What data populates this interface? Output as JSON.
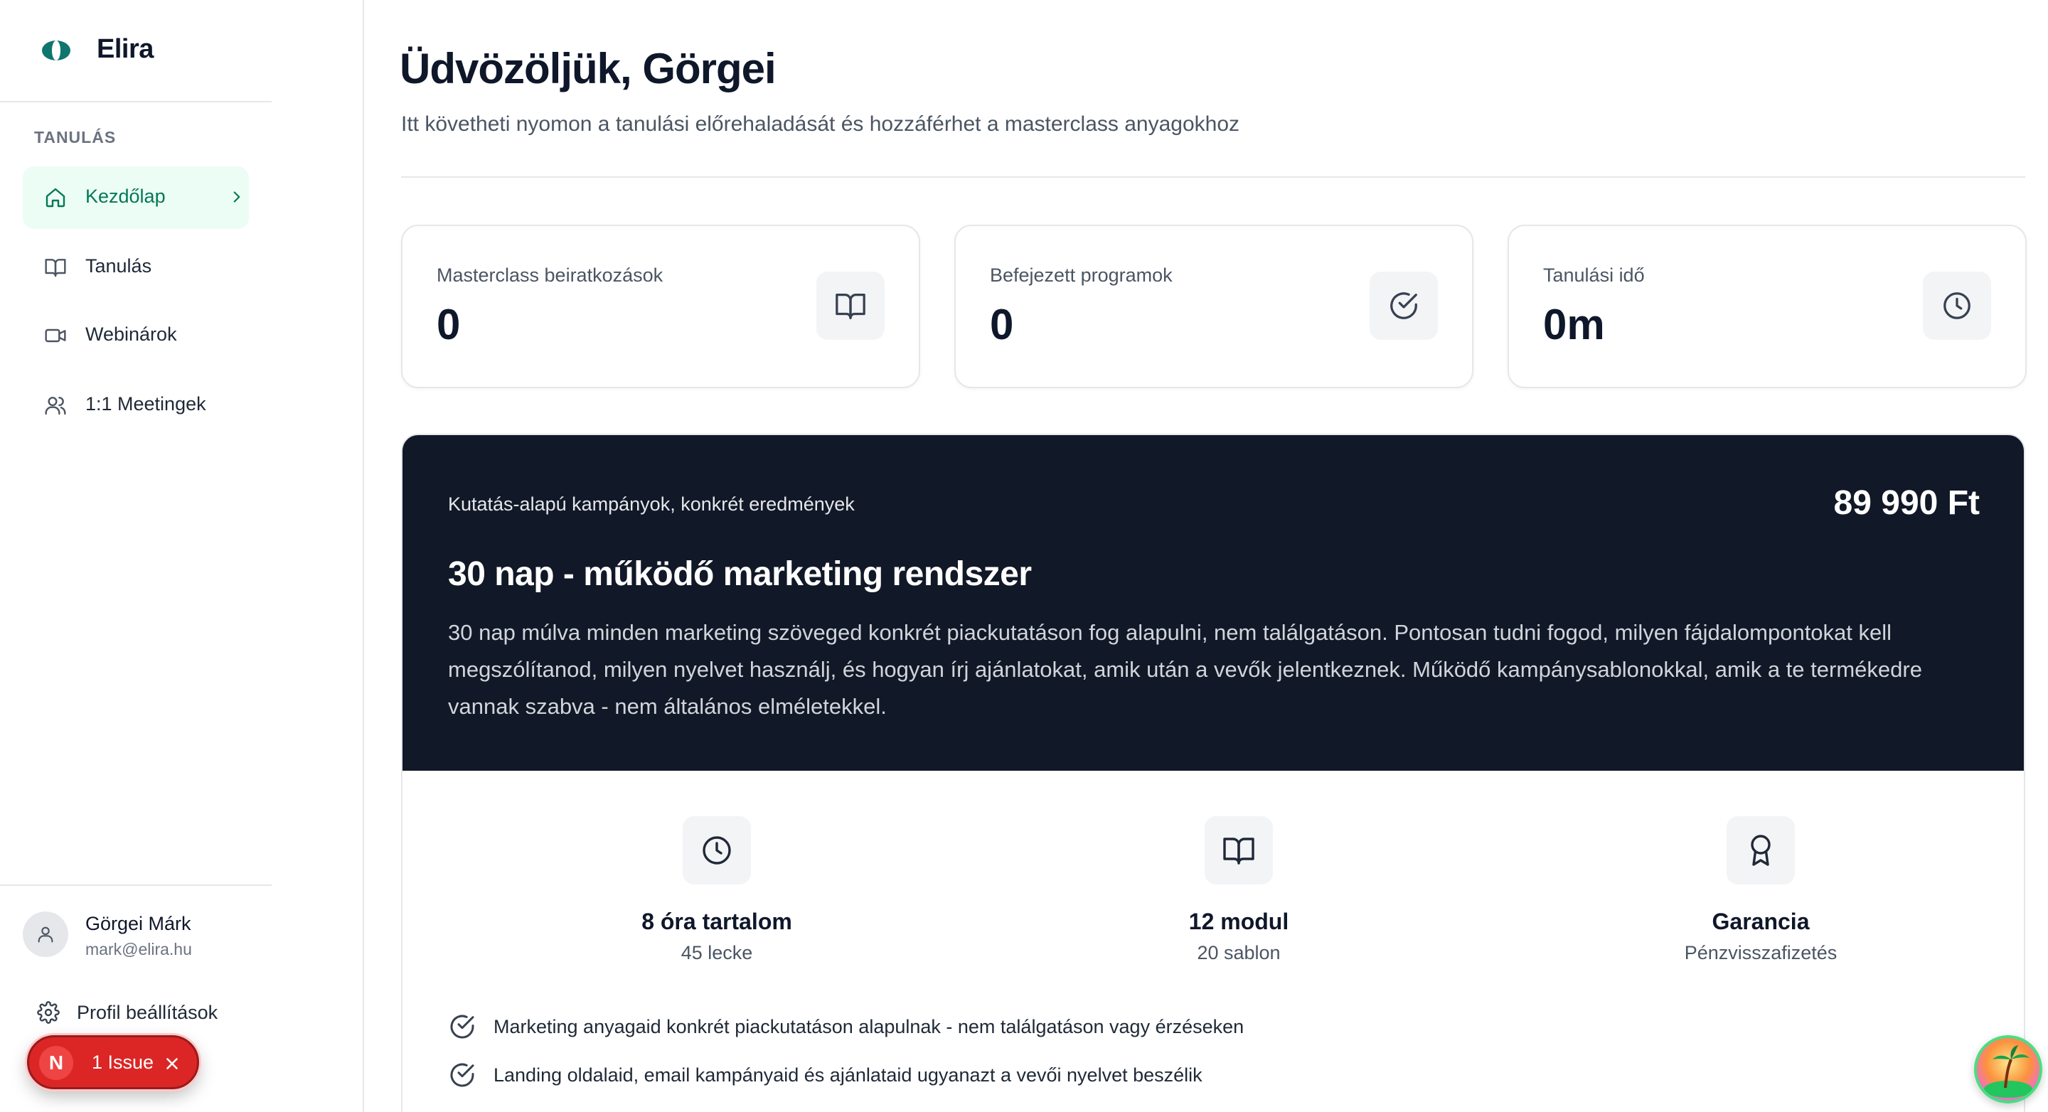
{
  "app": {
    "name": "Elira"
  },
  "sidebar": {
    "section_label": "TANULÁS",
    "items": [
      {
        "label": "Kezdőlap",
        "icon": "home-icon",
        "active": true
      },
      {
        "label": "Tanulás",
        "icon": "book-icon",
        "active": false
      },
      {
        "label": "Webinárok",
        "icon": "video-icon",
        "active": false
      },
      {
        "label": "1:1 Meetingek",
        "icon": "users-icon",
        "active": false
      }
    ],
    "user": {
      "name": "Görgei Márk",
      "email": "mark@elira.hu"
    },
    "profile_settings_label": "Profil beállítások",
    "issue_badge": {
      "letter": "N",
      "label": "1 Issue"
    }
  },
  "header": {
    "title": "Üdvözöljük, Görgei",
    "subtitle": "Itt követheti nyomon a tanulási előrehaladását és hozzáférhet a masterclass anyagokhoz"
  },
  "stats": [
    {
      "label": "Masterclass beiratkozások",
      "value": "0",
      "icon": "book-open-icon"
    },
    {
      "label": "Befejezett programok",
      "value": "0",
      "icon": "check-circle-icon"
    },
    {
      "label": "Tanulási idő",
      "value": "0m",
      "icon": "clock-icon"
    }
  ],
  "course": {
    "tagline": "Kutatás-alapú kampányok, konkrét eredmények",
    "price": "89 990 Ft",
    "title": "30 nap - működő marketing rendszer",
    "description": "30 nap múlva minden marketing szöveged konkrét piackutatáson fog alapulni, nem találgatáson. Pontosan tudni fogod, milyen fájdalompontokat kell megszólítanod, milyen nyelvet használj, és hogyan írj ajánlatokat, amik után a vevők jelentkeznek. Működő kampánysablonokkal, amik a te termékedre vannak szabva - nem általános elméletekkel.",
    "features": [
      {
        "title": "8 óra tartalom",
        "subtitle": "45 lecke",
        "icon": "clock-icon"
      },
      {
        "title": "12 modul",
        "subtitle": "20 sablon",
        "icon": "book-open-icon"
      },
      {
        "title": "Garancia",
        "subtitle": "Pénzvisszafizetés",
        "icon": "award-icon"
      }
    ],
    "benefits": [
      "Marketing anyagaid konkrét piackutatáson alapulnak - nem találgatáson vagy érzéseken",
      "Landing oldalaid, email kampányaid és ajánlataid ugyanazt a vevői nyelvet beszélik"
    ]
  },
  "colors": {
    "accent": "#047857",
    "accent_bg": "#ecfdf5",
    "dark_panel": "#111827",
    "issue_red": "#dc2626"
  }
}
